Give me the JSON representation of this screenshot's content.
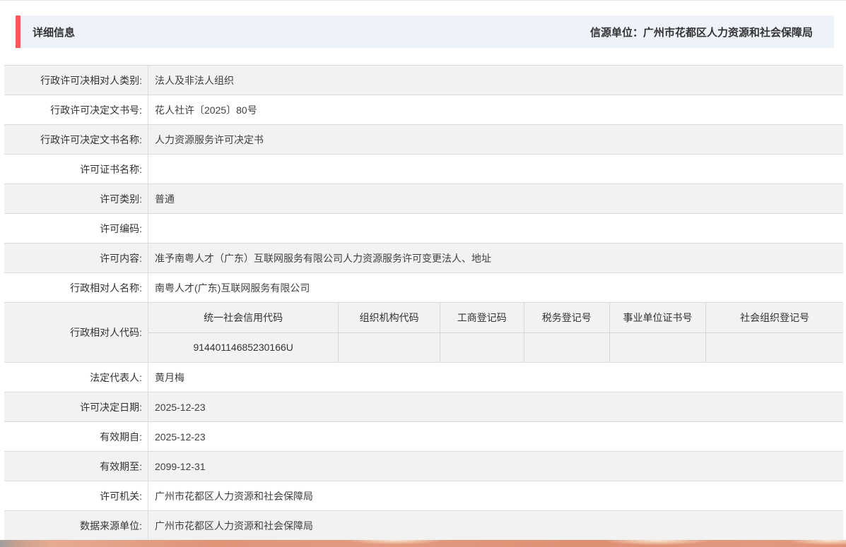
{
  "page": {
    "header": {
      "title": "详细信息",
      "source": "信源单位：广州市花都区人力资源和社会保障局"
    },
    "colors": {
      "accent_red": "#f65a5a",
      "header_bg": "#eef2f9",
      "alt_row_bg": "#f2f2f2",
      "border": "#dcdcdc"
    },
    "rows": [
      {
        "label": "行政许可决相对人类别:",
        "value": "法人及非法人组织"
      },
      {
        "label": "行政许可决定文书号:",
        "value": "花人社许〔2025〕80号"
      },
      {
        "label": "行政许可决定文书名称:",
        "value": "人力资源服务许可决定书"
      },
      {
        "label": "许可证书名称:",
        "value": ""
      },
      {
        "label": "许可类别:",
        "value": "普通"
      },
      {
        "label": "许可编码:",
        "value": ""
      },
      {
        "label": "许可内容:",
        "value": "准予南粤人才（广东）互联网服务有限公司人力资源服务许可变更法人、地址"
      },
      {
        "label": "行政相对人名称:",
        "value": "南粤人才(广东)互联网服务有限公司"
      },
      {
        "label": "行政相对人代码:",
        "type": "code-table"
      },
      {
        "label": "法定代表人:",
        "value": "黄月梅"
      },
      {
        "label": "许可决定日期:",
        "value": "2025-12-23"
      },
      {
        "label": "有效期自:",
        "value": "2025-12-23"
      },
      {
        "label": "有效期至:",
        "value": "2099-12-31"
      },
      {
        "label": "许可机关:",
        "value": "广州市花都区人力资源和社会保障局"
      },
      {
        "label": "数据来源单位:",
        "value": "广州市花都区人力资源和社会保障局"
      }
    ],
    "code_table": {
      "headers": [
        "统一社会信用代码",
        "组织机构代码",
        "工商登记码",
        "税务登记号",
        "事业单位证书号",
        "社会组织登记号"
      ],
      "values": [
        "91440114685230166U",
        "",
        "",
        "",
        "",
        ""
      ]
    }
  }
}
